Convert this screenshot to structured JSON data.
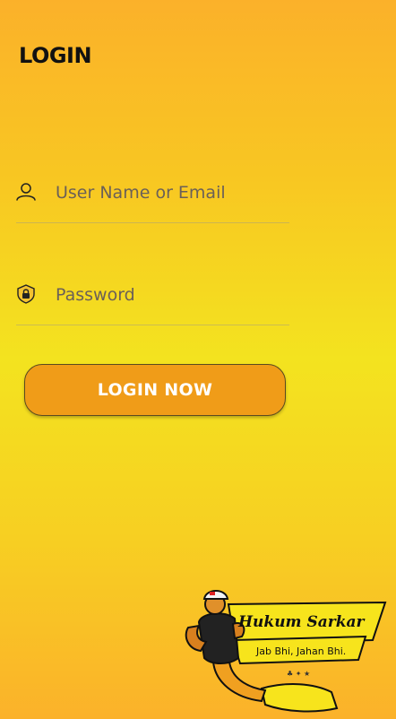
{
  "header": {
    "title": "LOGIN"
  },
  "form": {
    "username_placeholder": "User Name or Email",
    "username_icon": "user-icon",
    "password_placeholder": "Password",
    "password_icon": "lock-shield-icon",
    "submit_label": "LOGIN NOW"
  },
  "logo": {
    "brand": "Hukum Sarkar",
    "tagline": "Jab Bhi, Jahan Bhi."
  },
  "colors": {
    "background_top": "#fbb12a",
    "background_middle": "#f3e31f",
    "button": "#f09c18",
    "button_text": "#ffffff"
  }
}
